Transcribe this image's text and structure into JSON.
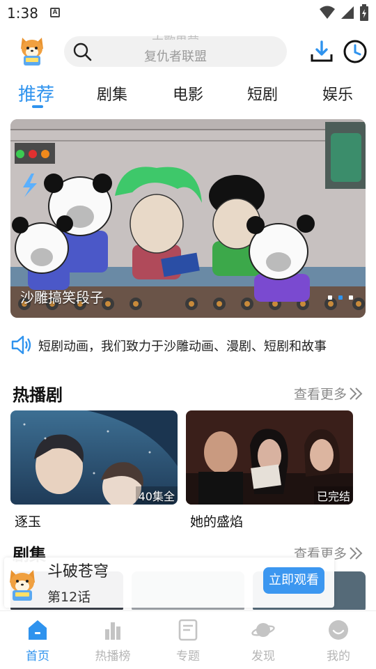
{
  "status_bar": {
    "time": "1:38",
    "notification_icon": "a-icon",
    "icons": [
      "wifi-icon",
      "signal-icon",
      "battery-icon"
    ]
  },
  "header": {
    "avatar": "shiba-mascot-icon",
    "search": {
      "placeholder_top": "大歌思营",
      "placeholder": "复仇者联盟",
      "icon": "search-icon"
    },
    "download_icon": "download-icon",
    "history_icon": "clock-icon"
  },
  "tabs": [
    {
      "label": "推荐",
      "active": true
    },
    {
      "label": "剧集"
    },
    {
      "label": "电影"
    },
    {
      "label": "短剧"
    },
    {
      "label": "娱乐"
    }
  ],
  "banner": {
    "caption": "沙雕搞笑段子",
    "slide_count": 3,
    "active_slide": 2
  },
  "notice": {
    "icon": "speaker-icon",
    "text": "短剧动画，我们致力于沙雕动画、漫剧、短剧和故事"
  },
  "sections": {
    "hot": {
      "title": "热播剧",
      "more": "查看更多",
      "items": [
        {
          "title": "逐玉",
          "badge": "40集全"
        },
        {
          "title": "她的盛焰",
          "badge": "已完结"
        }
      ]
    },
    "series": {
      "title": "剧集",
      "more": "查看更多"
    }
  },
  "popup": {
    "title": "斗破苍穹",
    "episode": "第12话",
    "button": "立即观看"
  },
  "bottom_nav": [
    {
      "label": "首页",
      "icon": "home-icon",
      "active": true
    },
    {
      "label": "热播榜",
      "icon": "bar-chart-icon"
    },
    {
      "label": "专题",
      "icon": "document-icon"
    },
    {
      "label": "发现",
      "icon": "planet-icon"
    },
    {
      "label": "我的",
      "icon": "profile-icon"
    }
  ],
  "colors": {
    "accent": "#2f93ee",
    "button": "#3c97f0",
    "inactive": "#b5b5b5"
  }
}
